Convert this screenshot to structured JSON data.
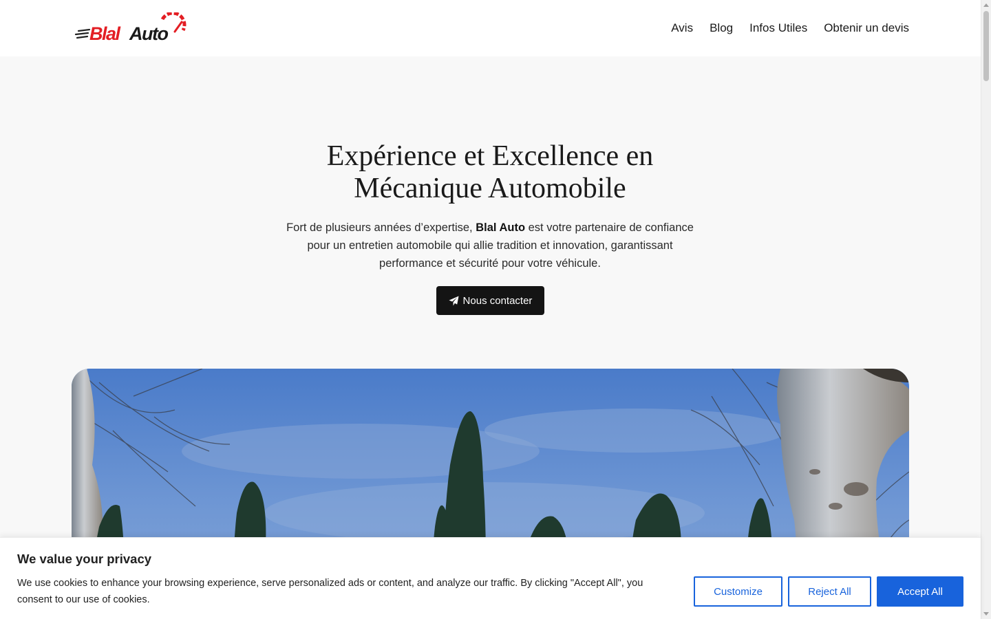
{
  "brand": {
    "logo_text": "BlalAuto",
    "accent": "#e31e24"
  },
  "nav": {
    "items": [
      "Avis",
      "Blog",
      "Infos Utiles",
      "Obtenir un devis"
    ]
  },
  "hero": {
    "title_line1": "Expérience et Excellence en",
    "title_line2": "Mécanique Automobile",
    "text_before": "Fort de plusieurs années d’expertise, ",
    "text_bold": "Blal Auto",
    "text_after": " est votre partenaire de confiance pour un entretien automobile qui allie tradition et innovation, garantissant performance et sécurité pour votre véhicule.",
    "cta_label": "Nous contacter",
    "cta_icon": "paper-plane-icon"
  },
  "cookie": {
    "title": "We value your privacy",
    "text": "We use cookies to enhance your browsing experience, serve personalized ads or content, and analyze our traffic. By clicking \"Accept All\", you consent to our use of cookies.",
    "customize_label": "Customize",
    "reject_label": "Reject All",
    "accept_label": "Accept All",
    "button_color": "#1863dc"
  }
}
